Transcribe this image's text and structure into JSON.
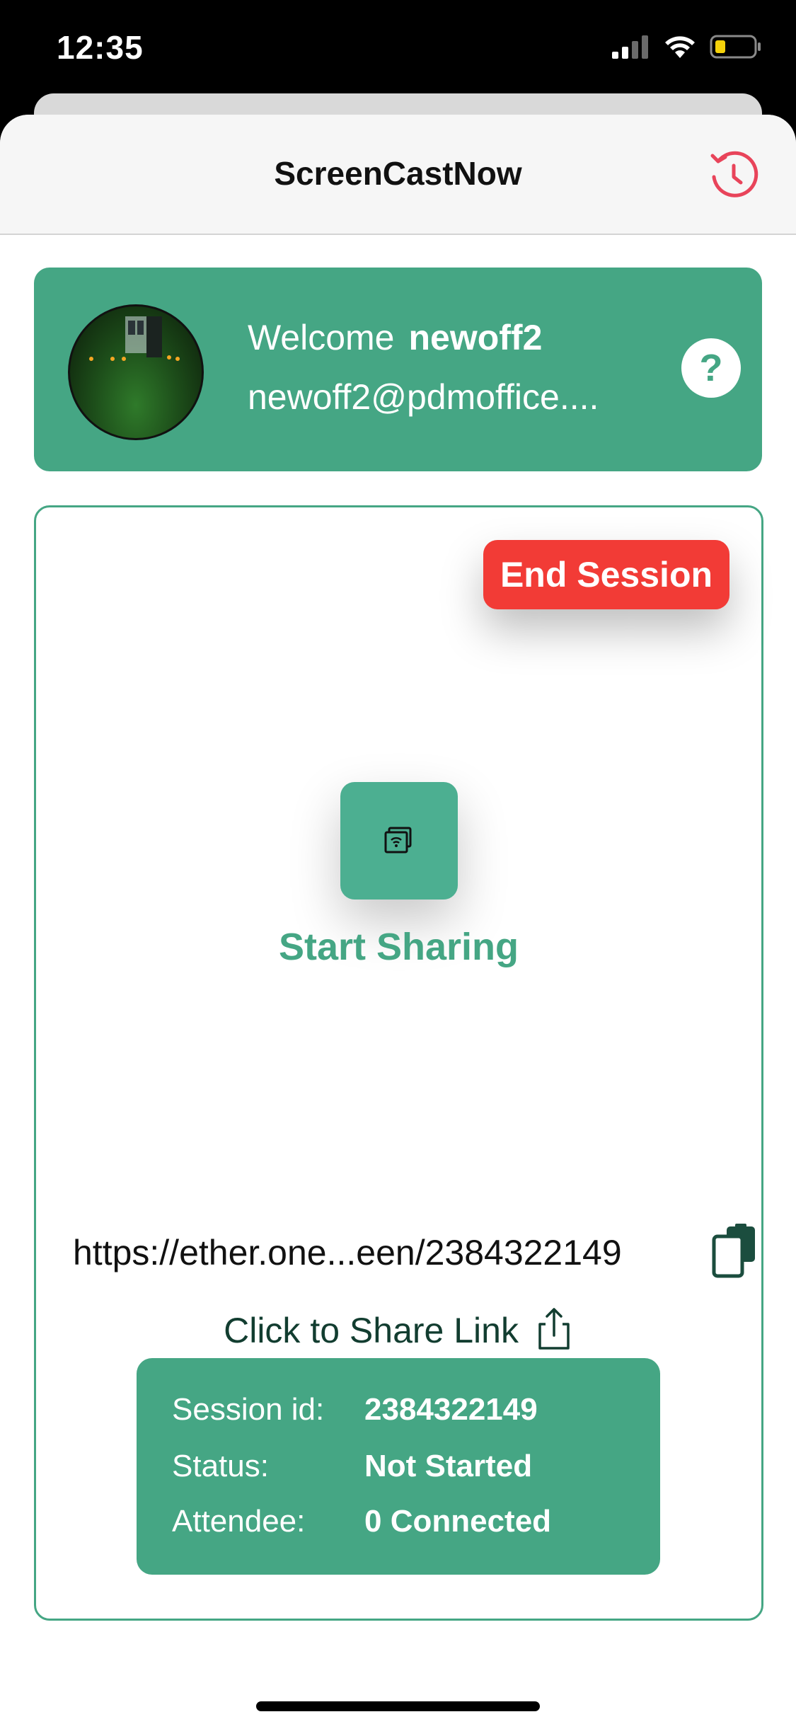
{
  "status_bar": {
    "time": "12:35"
  },
  "nav": {
    "title": "ScreenCastNow",
    "history_icon": "history-icon"
  },
  "welcome": {
    "greeting": "Welcome",
    "username": "newoff2",
    "email": "newoff2@pdmoffice....",
    "help_label": "?"
  },
  "session": {
    "end_label": "End Session",
    "share_icon": "screen-cast-icon",
    "start_label": "Start Sharing",
    "link": "https://ether.one...een/2384322149",
    "share_link_label": "Click to Share Link",
    "info": [
      {
        "key": "Session id:",
        "value": "2384322149"
      },
      {
        "key": "Status:",
        "value": "Not Started"
      },
      {
        "key": "Attendee:",
        "value": "0 Connected"
      }
    ]
  },
  "colors": {
    "brand_green": "#45a684",
    "danger_red": "#f23b36",
    "history_red": "#e8445a"
  }
}
